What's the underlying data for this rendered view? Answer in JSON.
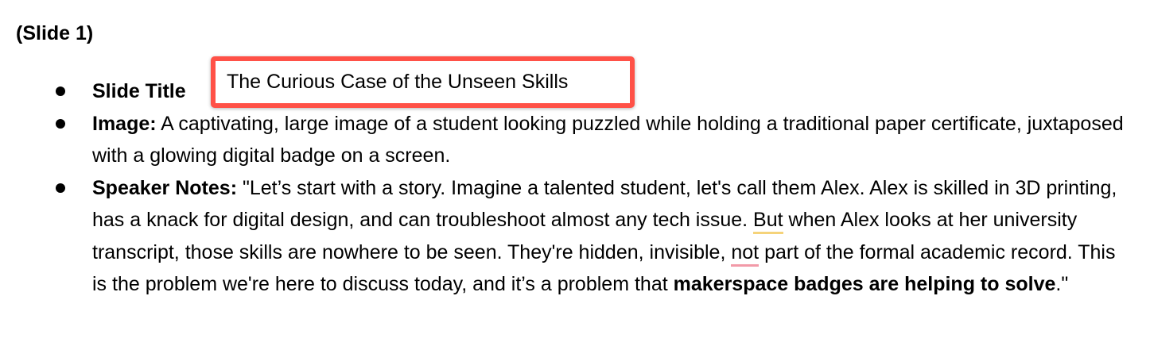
{
  "heading": "(Slide 1)",
  "bullets": [
    {
      "label": "Slide Title",
      "value": "The Curious Case of the Unseen Skills"
    },
    {
      "label": "Image:",
      "text": " A captivating, large image of a student looking puzzled while holding a traditional paper certificate, juxtaposed with a glowing digital badge on a screen."
    },
    {
      "label": "Speaker Notes:",
      "text_1": " \"Let’s start with a story. Imagine a talented student, let's call them Alex. Alex is skilled in 3D printing, has a knack for digital design, and can troubleshoot almost any tech issue. ",
      "flag_1": "But",
      "text_2": " when Alex looks at her university transcript, those skills are nowhere to be seen. They're hidden, invisible, ",
      "flag_2": "not",
      "text_3": " part of the formal academic record. This is the problem we're here to discuss today, and it’s a problem that ",
      "emphasis": "makerspace badges are helping to solve",
      "text_4": ".\""
    }
  ],
  "colors": {
    "highlight_border": "#ff5147",
    "spell_yellow": "#f5d37a",
    "spell_red": "#f29aa8"
  }
}
